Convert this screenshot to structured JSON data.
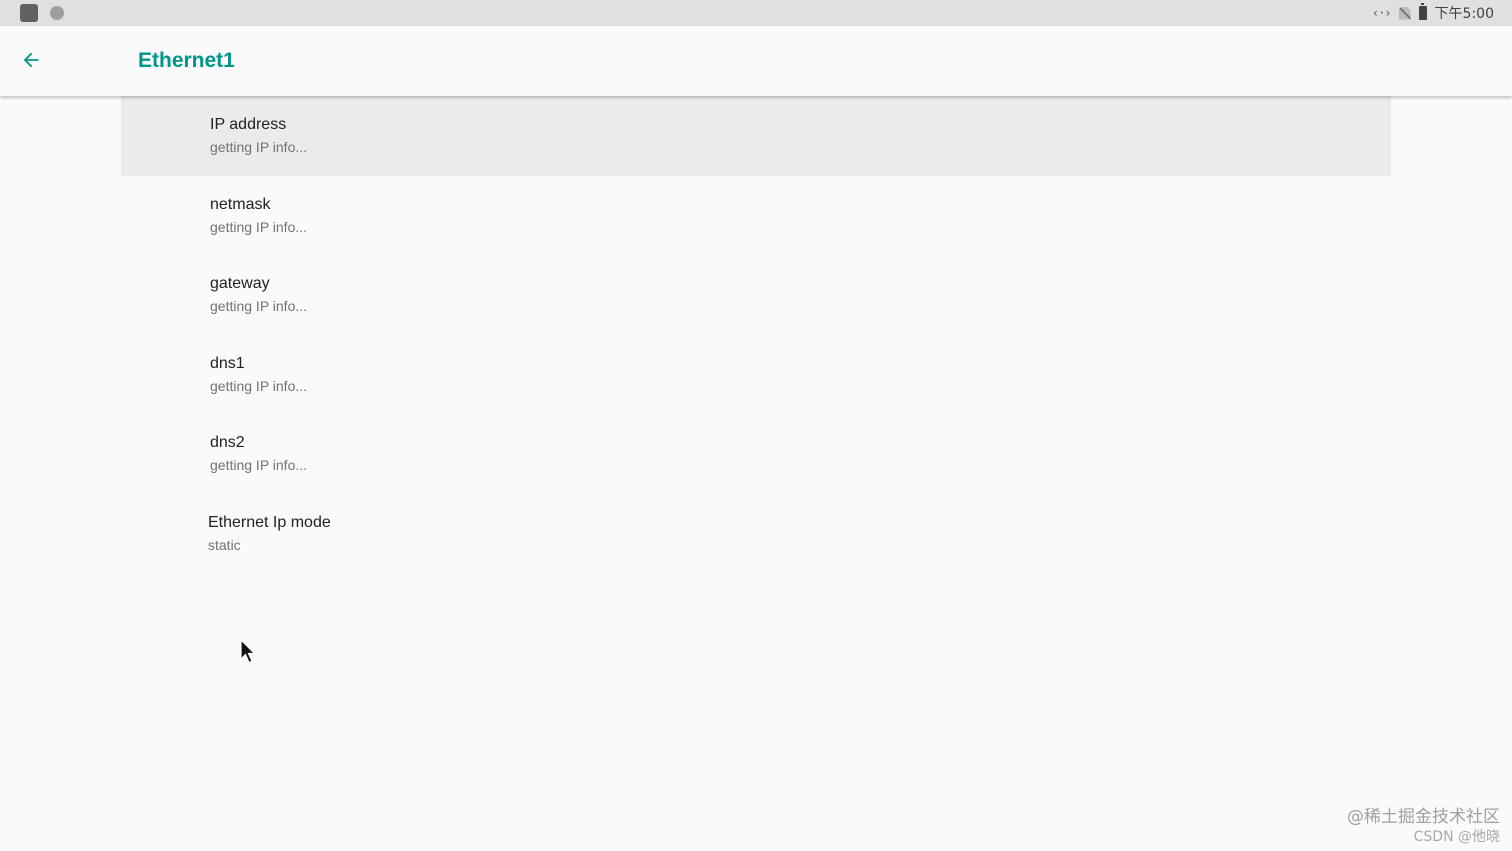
{
  "status_bar": {
    "clock": "下午5:00",
    "icons": [
      "stop-square-icon",
      "circle-dot-icon",
      "ethernet-icon",
      "no-sim-icon",
      "battery-icon"
    ]
  },
  "app_bar": {
    "back_icon": "arrow-back-icon",
    "title": "Ethernet1",
    "accent_color": "#009688"
  },
  "preferences": [
    {
      "title": "IP address",
      "summary": "getting IP info..."
    },
    {
      "title": "netmask",
      "summary": "getting IP info..."
    },
    {
      "title": "gateway",
      "summary": "getting IP info..."
    },
    {
      "title": "dns1",
      "summary": "getting IP info..."
    },
    {
      "title": "dns2",
      "summary": "getting IP info..."
    },
    {
      "title": "Ethernet Ip mode",
      "summary": "static"
    }
  ],
  "watermark": {
    "line1": "@稀土掘金技术社区",
    "line2": "CSDN @他晓"
  }
}
